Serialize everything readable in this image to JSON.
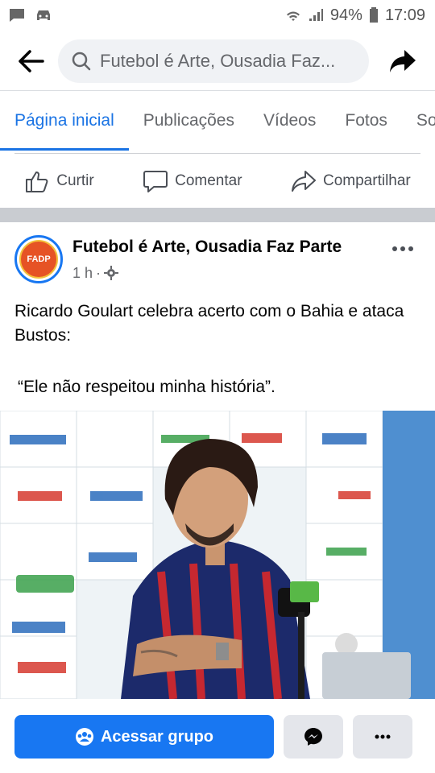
{
  "status": {
    "battery": "94%",
    "time": "17:09"
  },
  "search": {
    "text": "Futebol é Arte, Ousadia Faz..."
  },
  "tabs": [
    {
      "label": "Página inicial",
      "active": true
    },
    {
      "label": "Publicações"
    },
    {
      "label": "Vídeos"
    },
    {
      "label": "Fotos"
    },
    {
      "label": "Sol"
    }
  ],
  "actions": {
    "like": "Curtir",
    "comment": "Comentar",
    "share": "Compartilhar"
  },
  "post": {
    "author": "Futebol é Arte, Ousadia Faz Parte",
    "time": "1 h",
    "separator": "·",
    "text": "Ricardo Goulart celebra acerto com o Bahia e ataca Bustos:",
    "quote": "“Ele não respeitou minha história”.",
    "avatar_text": "FADP"
  },
  "bottom": {
    "join_label": "Acessar grupo"
  },
  "colors": {
    "accent": "#1877f2",
    "tab_active": "#1b74e4"
  }
}
